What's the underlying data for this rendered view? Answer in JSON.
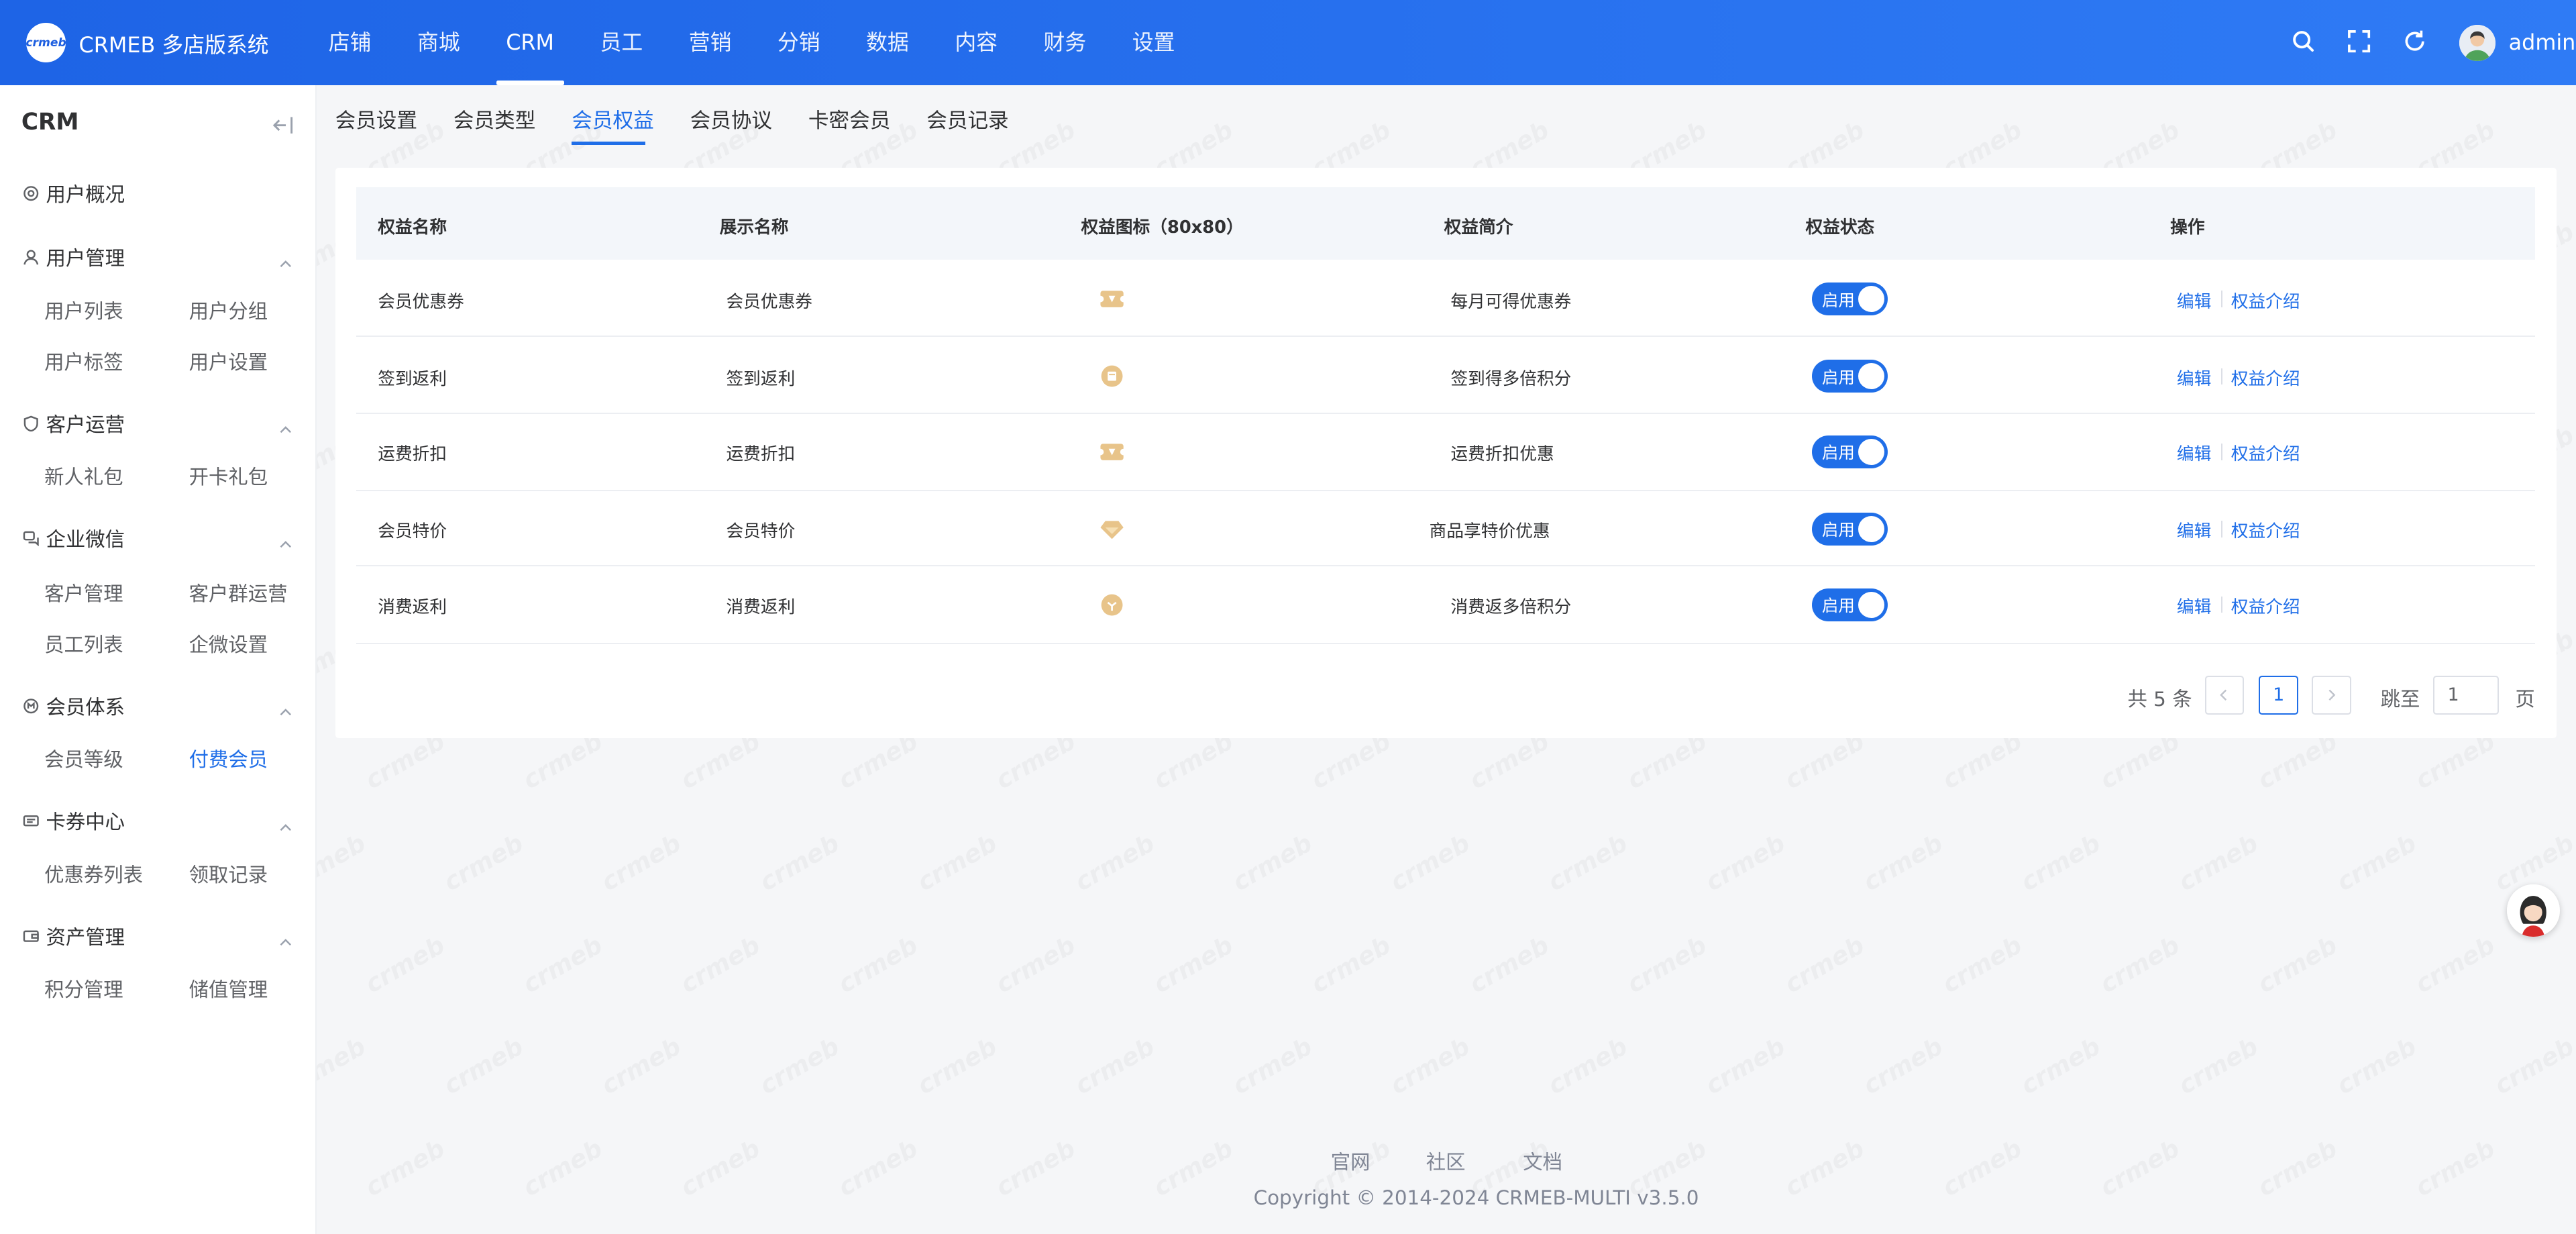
{
  "app": {
    "title": "CRMEB 多店版系统",
    "logo_text": "crmeb"
  },
  "topnav": [
    {
      "label": "店铺",
      "active": false
    },
    {
      "label": "商城",
      "active": false
    },
    {
      "label": "CRM",
      "active": true
    },
    {
      "label": "员工",
      "active": false
    },
    {
      "label": "营销",
      "active": false
    },
    {
      "label": "分销",
      "active": false
    },
    {
      "label": "数据",
      "active": false
    },
    {
      "label": "内容",
      "active": false
    },
    {
      "label": "财务",
      "active": false
    },
    {
      "label": "设置",
      "active": false
    }
  ],
  "header": {
    "username": "admin",
    "icons": [
      "search-icon",
      "fullscreen-icon",
      "refresh-icon",
      "avatar"
    ]
  },
  "sidebar": {
    "title": "CRM",
    "groups": [
      {
        "label": "用户概况",
        "icon": "dashboard-icon",
        "items": []
      },
      {
        "label": "用户管理",
        "icon": "user-icon",
        "items": [
          "用户列表",
          "用户分组",
          "用户标签",
          "用户设置"
        ]
      },
      {
        "label": "客户运营",
        "icon": "shield-icon",
        "items": [
          "新人礼包",
          "开卡礼包"
        ]
      },
      {
        "label": "企业微信",
        "icon": "chat-icon",
        "items": [
          "客户管理",
          "客户群运营",
          "员工列表",
          "企微设置"
        ]
      },
      {
        "label": "会员体系",
        "icon": "member-icon",
        "items": [
          "会员等级",
          "付费会员"
        ]
      },
      {
        "label": "卡券中心",
        "icon": "ticket-icon",
        "items": [
          "优惠券列表",
          "领取记录"
        ]
      },
      {
        "label": "资产管理",
        "icon": "wallet-icon",
        "items": [
          "积分管理",
          "储值管理"
        ]
      }
    ],
    "active_item": "付费会员"
  },
  "subtabs": [
    {
      "label": "会员设置",
      "active": false
    },
    {
      "label": "会员类型",
      "active": false
    },
    {
      "label": "会员权益",
      "active": true
    },
    {
      "label": "会员协议",
      "active": false
    },
    {
      "label": "卡密会员",
      "active": false
    },
    {
      "label": "会员记录",
      "active": false
    }
  ],
  "table": {
    "columns": [
      "权益名称",
      "展示名称",
      "权益图标（80x80）",
      "权益简介",
      "权益状态",
      "操作"
    ],
    "rows": [
      {
        "name": "会员优惠券",
        "display": "会员优惠券",
        "icon": "coupon-icon",
        "intro": "每月可得优惠券",
        "status": "启用"
      },
      {
        "name": "签到返利",
        "display": "签到返利",
        "icon": "checkin-coin-icon",
        "intro": "签到得多倍积分",
        "status": "启用"
      },
      {
        "name": "运费折扣",
        "display": "运费折扣",
        "icon": "shipping-coupon-icon",
        "intro": "运费折扣优惠",
        "status": "启用"
      },
      {
        "name": "会员特价",
        "display": "会员特价",
        "icon": "diamond-icon",
        "intro": "商品享特价优惠",
        "status": "启用"
      },
      {
        "name": "消费返利",
        "display": "消费返利",
        "icon": "rebate-coin-icon",
        "intro": "消费返多倍积分",
        "status": "启用"
      }
    ],
    "actions": {
      "edit": "编辑",
      "intro": "权益介绍"
    }
  },
  "pagination": {
    "total_text": "共 5 条",
    "current_page": "1",
    "jump_label": "跳至",
    "jump_value": "1",
    "page_suffix": "页"
  },
  "footer": {
    "links": [
      "官网",
      "社区",
      "文档"
    ],
    "copyright": "Copyright © 2014-2024 CRMEB-MULTI v3.5.0"
  },
  "colors": {
    "header_start": "#1e64e6",
    "header_end": "#2f7bf5",
    "accent": "#1f6ee8",
    "background": "#f5f6f8"
  }
}
